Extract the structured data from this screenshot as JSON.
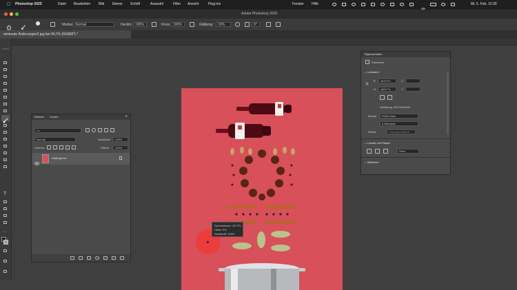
{
  "menubar": {
    "app_name": "Photoshop 2025",
    "items": [
      "Datei",
      "Bearbeiten",
      "Bild",
      "Ebene",
      "Schrift",
      "Auswahl",
      "Filter",
      "Ansicht",
      "Plug-ins"
    ],
    "right_items": [
      "Fenster",
      "Hilfe"
    ],
    "clock": "Mi. 5. Feb. 12:30"
  },
  "window": {
    "title": "Adobe Photoshop 2025"
  },
  "options_bar": {
    "mode_label": "Modus:",
    "mode_value": "Normal",
    "opacity_label": "Deckkr.:",
    "opacity_value": "100%",
    "flow_label": "Fluss:",
    "flow_value": "100%",
    "smoothing_label": "Glättung:",
    "smoothing_value": "10%",
    "angle_value": "0°"
  },
  "document": {
    "tab_title": "minimale Änderungen2.jpg bei 40,7% (RGB/8*) *"
  },
  "layers_panel": {
    "tabs": [
      "Ebenen",
      "Kanäle"
    ],
    "filter_placeholder": "Art",
    "blend_mode": "Normal",
    "opacity_label": "Deckkraft:",
    "opacity_value": "100%",
    "lock_label": "Fixieren:",
    "fill_label": "Fläche:",
    "fill_value": "100%",
    "layers": [
      {
        "name": "Hintergrund"
      }
    ]
  },
  "properties_panel": {
    "title": "Eigenschaften",
    "doc_tab": "Dokument",
    "canvas_section": "Leinwand",
    "width_label": "B",
    "width_value": "3670 Px",
    "height_label": "H",
    "height_value": "4800 Px",
    "x_label": "X",
    "y_label": "Y",
    "resolution": "Auflösung: 300 Pixel/Zoll",
    "mode_label": "Modus",
    "mode_value": "RGB-Farbe",
    "bit_value": "8 Bit/Kanal",
    "fill_label": "Fläche",
    "fill_value": "Hintergrundfarbe",
    "rulers_section": "Lineale und Raster",
    "units_value": "Pixel",
    "guides_section": "Hilfslinien"
  },
  "brush_tooltip": {
    "diameter": "Durchmesser: 427 Px",
    "hardness": "Härte: 0%",
    "opacity": "Deckkraft: 100%"
  },
  "colors": {
    "accent": "#2e6fd8",
    "canvas_bg": "#d7505a",
    "brush": "#f03a3a",
    "chrome": "#3f3f3f"
  },
  "icons": [
    "apple-icon",
    "home-icon",
    "brush-tool-icon",
    "eye-icon",
    "lock-icon",
    "link-icon",
    "wifi-icon",
    "battery-icon"
  ]
}
